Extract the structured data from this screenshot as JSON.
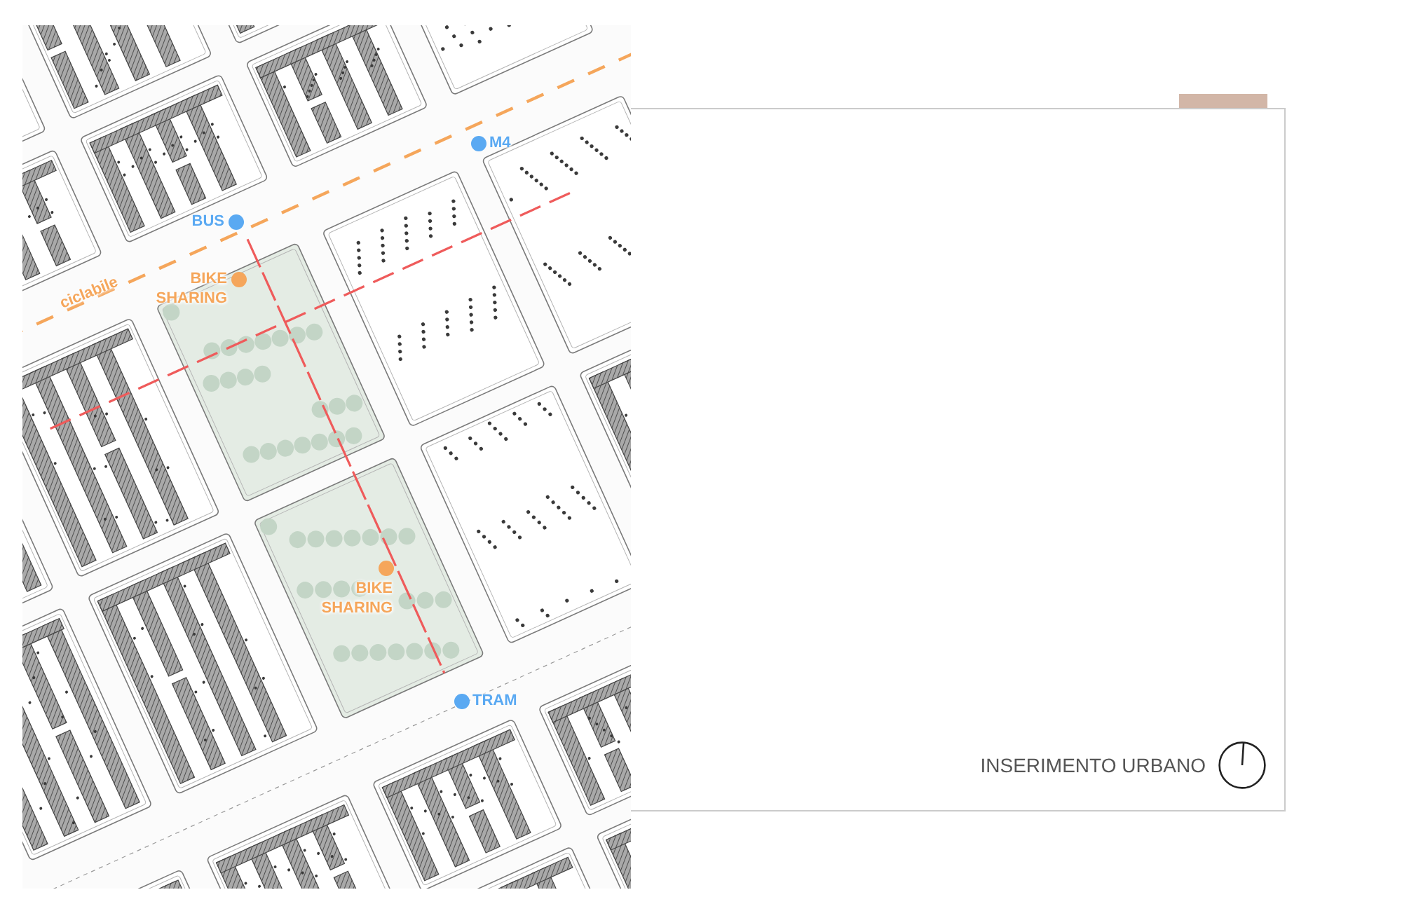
{
  "map": {
    "bike_lane_label": "ciclabile",
    "pins": [
      {
        "label": "M4",
        "color": "#5aa9f2"
      },
      {
        "label": "BUS",
        "color": "#5aa9f2"
      },
      {
        "label": "BIKE SHARING",
        "color": "#f5a65b"
      },
      {
        "label": "BIKE SHARING",
        "color": "#f5a65b"
      },
      {
        "label": "TRAM",
        "color": "#5aa9f2"
      }
    ]
  },
  "panel": {
    "caption": "INSERIMENTO URBANO"
  }
}
